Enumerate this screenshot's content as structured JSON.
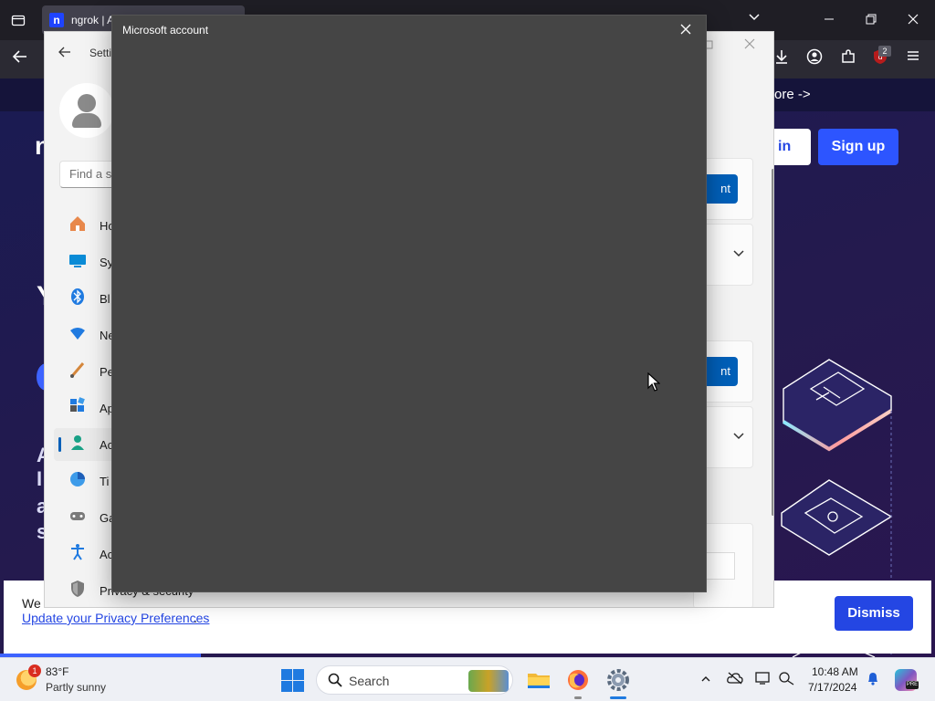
{
  "browser": {
    "tab": {
      "favicon": "n",
      "title": "ngrok | A"
    },
    "nav_icons": [
      "back-arrow-icon",
      "download-icon",
      "account-icon",
      "extensions-icon",
      "ublock-icon",
      "menu-icon"
    ],
    "ublock_badge": "2"
  },
  "website": {
    "promo_text": "ore ->",
    "login_label": "in",
    "signup_label": "Sign up",
    "hero_fragments": {
      "n": "n",
      "y": "Y",
      "a": "A",
      "i": "I",
      "a2": "a",
      "s": "s"
    },
    "cookie_banner": {
      "text": "We",
      "link": "Update your Privacy Preferences",
      "link_suffix": ".",
      "dismiss_label": "Dismiss"
    },
    "brand_color": "#2d55ff"
  },
  "settings": {
    "title": "Setti",
    "search_placeholder": "Find a s",
    "nav_items": [
      {
        "label": "Ho",
        "icon": "home-icon"
      },
      {
        "label": "Sy",
        "icon": "system-icon"
      },
      {
        "label": "Bl",
        "icon": "bluetooth-icon"
      },
      {
        "label": "Ne",
        "icon": "network-icon"
      },
      {
        "label": "Pe",
        "icon": "personalization-icon"
      },
      {
        "label": "Ap",
        "icon": "apps-icon"
      },
      {
        "label": "Ac",
        "icon": "accounts-icon"
      },
      {
        "label": "Ti",
        "icon": "time-language-icon"
      },
      {
        "label": "Ga",
        "icon": "gaming-icon"
      },
      {
        "label": "Ac",
        "icon": "accessibility-icon"
      },
      {
        "label": "Privacy & security",
        "icon": "privacy-shield-icon"
      }
    ],
    "selected_index": 6,
    "content": {
      "button_1_label": "nt",
      "button_2_label": "nt"
    },
    "accent_color": "#005fb8"
  },
  "dialog": {
    "title": "Microsoft account",
    "close_icon": "close-icon"
  },
  "taskbar": {
    "weather": {
      "temp": "83°F",
      "desc": "Partly sunny",
      "badge": "1"
    },
    "search_label": "Search",
    "clock": {
      "time": "10:48 AM",
      "date": "7/17/2024"
    },
    "copilot_badge": "PRE"
  }
}
